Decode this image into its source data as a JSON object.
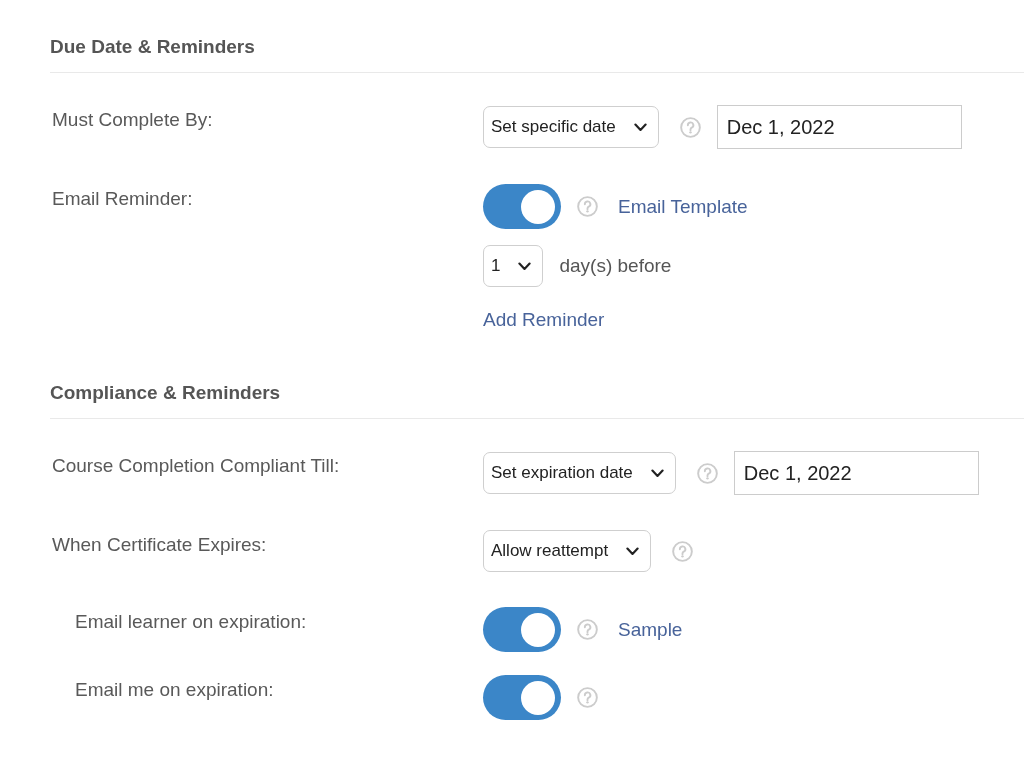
{
  "sections": [
    {
      "title": "Due Date & Reminders",
      "rows": [
        {
          "label": "Must Complete By:",
          "lines": [
            {
              "controls": [
                {
                  "kind": "dropdown",
                  "value": "Set specific date"
                },
                {
                  "kind": "help"
                },
                {
                  "kind": "date",
                  "value": "Dec 1, 2022"
                }
              ]
            }
          ]
        },
        {
          "label": "Email Reminder:",
          "lines": [
            {
              "controls": [
                {
                  "kind": "toggle",
                  "on": true
                },
                {
                  "kind": "help"
                },
                {
                  "kind": "link",
                  "text": "Email Template"
                }
              ]
            },
            {
              "controls": [
                {
                  "kind": "dropdown",
                  "value": "1"
                },
                {
                  "kind": "text",
                  "text": "day(s) before"
                }
              ]
            },
            {
              "controls": [
                {
                  "kind": "link",
                  "text": "Add Reminder"
                }
              ]
            }
          ]
        }
      ]
    },
    {
      "title": "Compliance & Reminders",
      "rows": [
        {
          "label": "Course Completion Compliant Till:",
          "lines": [
            {
              "controls": [
                {
                  "kind": "dropdown",
                  "value": "Set expiration date"
                },
                {
                  "kind": "help"
                },
                {
                  "kind": "date",
                  "value": "Dec 1, 2022"
                }
              ]
            }
          ]
        },
        {
          "label": "When Certificate Expires:",
          "lines": [
            {
              "controls": [
                {
                  "kind": "dropdown",
                  "value": "Allow reattempt"
                },
                {
                  "kind": "help"
                }
              ]
            }
          ],
          "children": [
            {
              "label": "Email learner on expiration:",
              "lines": [
                {
                  "controls": [
                    {
                      "kind": "toggle",
                      "on": true
                    },
                    {
                      "kind": "help"
                    },
                    {
                      "kind": "link",
                      "text": "Sample"
                    }
                  ]
                }
              ]
            },
            {
              "label": "Email me on expiration:",
              "lines": [
                {
                  "controls": [
                    {
                      "kind": "toggle",
                      "on": true
                    },
                    {
                      "kind": "help"
                    }
                  ]
                }
              ]
            }
          ]
        }
      ]
    }
  ]
}
